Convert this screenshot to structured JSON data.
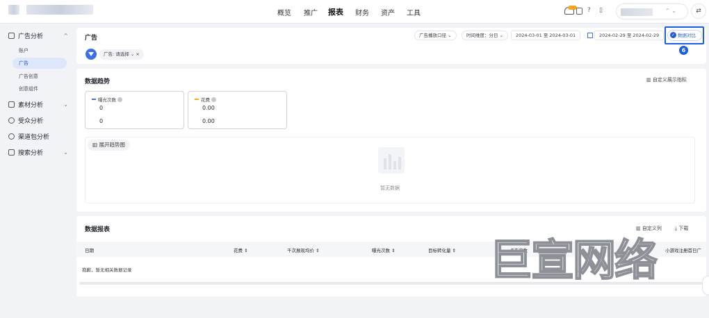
{
  "topbar": {
    "nav": [
      "概览",
      "推广",
      "报表",
      "财务",
      "资产",
      "工具"
    ],
    "acct_caret": "⌃ ⌄",
    "swap_icon": "⇄",
    "help_icon": "?",
    "phone_icon": "▯"
  },
  "sidebar": {
    "groups": [
      {
        "label": "广告分析",
        "arrow": "^"
      },
      {
        "label": "素材分析",
        "arrow": "⌄"
      },
      {
        "label": "受众分析",
        "arrow": ""
      },
      {
        "label": "渠道包分析",
        "arrow": ""
      },
      {
        "label": "搜索分析",
        "arrow": "⌄"
      }
    ],
    "subs": [
      "账户",
      "广告",
      "广告创意",
      "创意组件"
    ]
  },
  "ad_panel": {
    "title": "广告",
    "filter_label": "广告: 请选择 ⌄ ×",
    "pills": [
      "广告播放口径 ⌄",
      "时间维度：分日 ⌄",
      "2024-03-01 至 2024-03-01",
      "2024-02-29 至 2024-02-29"
    ],
    "compare_label": "数据对比",
    "step_number": "6"
  },
  "trend_panel": {
    "title": "数据趋势",
    "custom_metric": "自定义展示指标",
    "metrics": [
      {
        "label": "曝光次数",
        "value1": "0",
        "value2": "0",
        "color": "#4a6fe3"
      },
      {
        "label": "花费",
        "value1": "0.00",
        "value2": "0.00",
        "color": "#f5a623"
      }
    ],
    "expand_label": "展开趋势图",
    "empty_text": "暂无数据"
  },
  "report_panel": {
    "title": "数据报表",
    "custom_cols": "自定义列",
    "download": "下载",
    "columns": [
      "日期",
      "花费 ⇕",
      "千次展现均价 ⇕",
      "曝光次数 ⇕",
      "目标转化量 ⇕",
      "点击次数",
      "小游戏注册首日广"
    ],
    "empty_row": "抱歉，暂无相关数据记录"
  },
  "watermark": "巨宣网络"
}
